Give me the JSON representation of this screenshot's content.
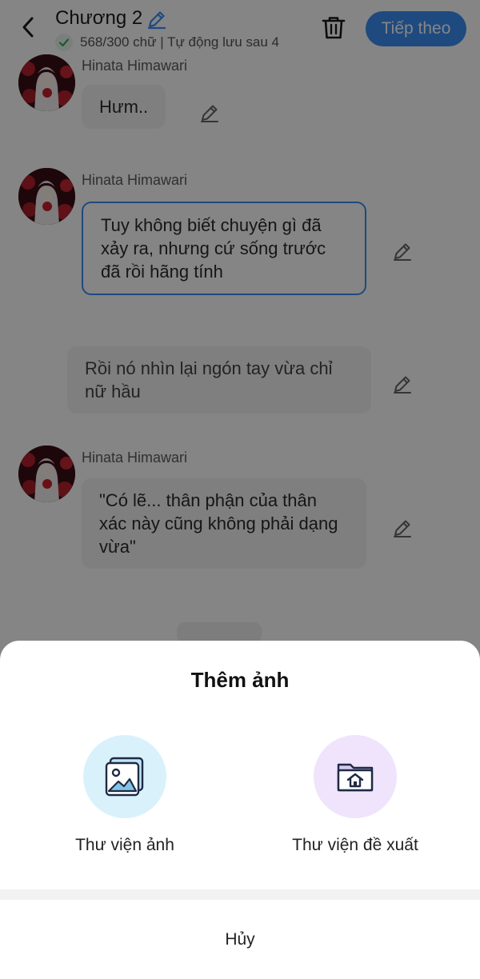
{
  "header": {
    "title": "Chương 2",
    "word_status": "568/300 chữ | Tự động lưu sau 4",
    "next_label": "Tiếp theo",
    "icons": [
      "back-arrow-icon",
      "pencil-icon",
      "check-icon",
      "trash-icon"
    ],
    "accent_color": "#3b8ff3"
  },
  "messages": [
    {
      "sender": "Hinata Himawari",
      "text": "Hưm..",
      "has_avatar": true
    },
    {
      "sender": "Hinata Himawari",
      "text": "Tuy không biết chuyện gì đã xảy ra, nhưng cứ sống trước đã rồi hãng tính",
      "has_avatar": true,
      "selected": true
    },
    {
      "sender": "",
      "text": "Rồi nó nhìn lại ngón tay vừa chỉ nữ hầu",
      "has_avatar": false
    },
    {
      "sender": "Hinata Himawari",
      "text": "\"Có lẽ... thân phận của thân xác này cũng không phải dạng vừa\"",
      "has_avatar": true
    }
  ],
  "sheet": {
    "title": "Thêm ảnh",
    "options": [
      {
        "label": "Thư viện ảnh",
        "icon": "photo-gallery-icon",
        "bg": "#d9f1fb"
      },
      {
        "label": "Thư viện đề xuất",
        "icon": "suggested-library-icon",
        "bg": "#efe4fb"
      }
    ],
    "cancel_label": "Hủy"
  }
}
